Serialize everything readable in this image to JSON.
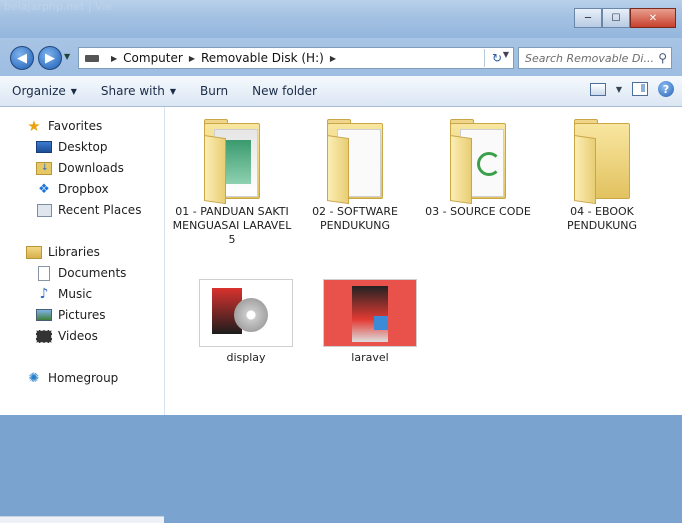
{
  "window": {
    "bg_tab_text": "belajarphp.net | Vie",
    "buttons": {
      "minimize": "─",
      "maximize": "☐",
      "close": "✕"
    }
  },
  "address": {
    "back_label": "◀",
    "forward_label": "▶",
    "crumbs": [
      "Computer",
      "Removable Disk (H:)"
    ],
    "refresh_label": "↻",
    "search_placeholder": "Search Removable Di..."
  },
  "toolbar": {
    "organize": "Organize",
    "share_with": "Share with",
    "burn": "Burn",
    "new_folder": "New folder",
    "help": "?"
  },
  "sidebar": {
    "favorites_header": "Favorites",
    "favorites": [
      "Desktop",
      "Downloads",
      "Dropbox",
      "Recent Places"
    ],
    "libraries_header": "Libraries",
    "libraries": [
      "Documents",
      "Music",
      "Pictures",
      "Videos"
    ],
    "homegroup": "Homegroup"
  },
  "files": {
    "folders": [
      "01 - PANDUAN SAKTI MENGUASAI LARAVEL 5",
      "02 - SOFTWARE PENDUKUNG",
      "03 - SOURCE CODE",
      "04 - EBOOK PENDUKUNG"
    ],
    "images": [
      "display",
      "laravel"
    ]
  },
  "colors": {
    "accent": "#2463b6",
    "folder": "#e2c260",
    "title_bg": "#a5c2e3"
  }
}
